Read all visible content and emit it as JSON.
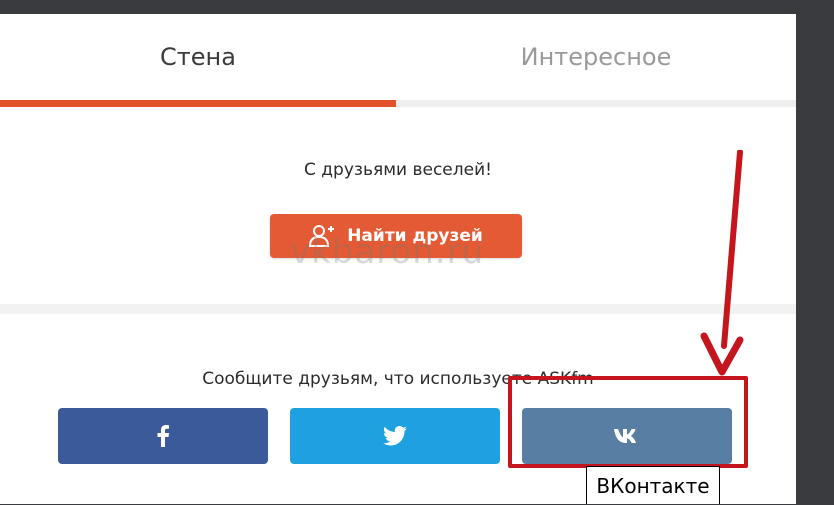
{
  "tabs": {
    "wall": "Стена",
    "interesting": "Интересное"
  },
  "friends": {
    "message": "С друзьями веселей!",
    "find_button_label": "Найти друзей",
    "find_button_icon": "add-user-icon"
  },
  "watermark": "vkbaron.ru",
  "share": {
    "message": "Сообщите друзьям, что используете ASKfm",
    "buttons": [
      {
        "network": "facebook",
        "icon": "facebook-icon",
        "color": "#3b5a9a"
      },
      {
        "network": "twitter",
        "icon": "twitter-icon",
        "color": "#1fa1e1"
      },
      {
        "network": "vk",
        "icon": "vk-icon",
        "color": "#587ea4"
      }
    ]
  },
  "annotation": {
    "caption": "ВКонтакте",
    "highlight_color": "#c4161c"
  },
  "colors": {
    "accent": "#e35a34",
    "active_tab_underline": "#e2532c"
  }
}
